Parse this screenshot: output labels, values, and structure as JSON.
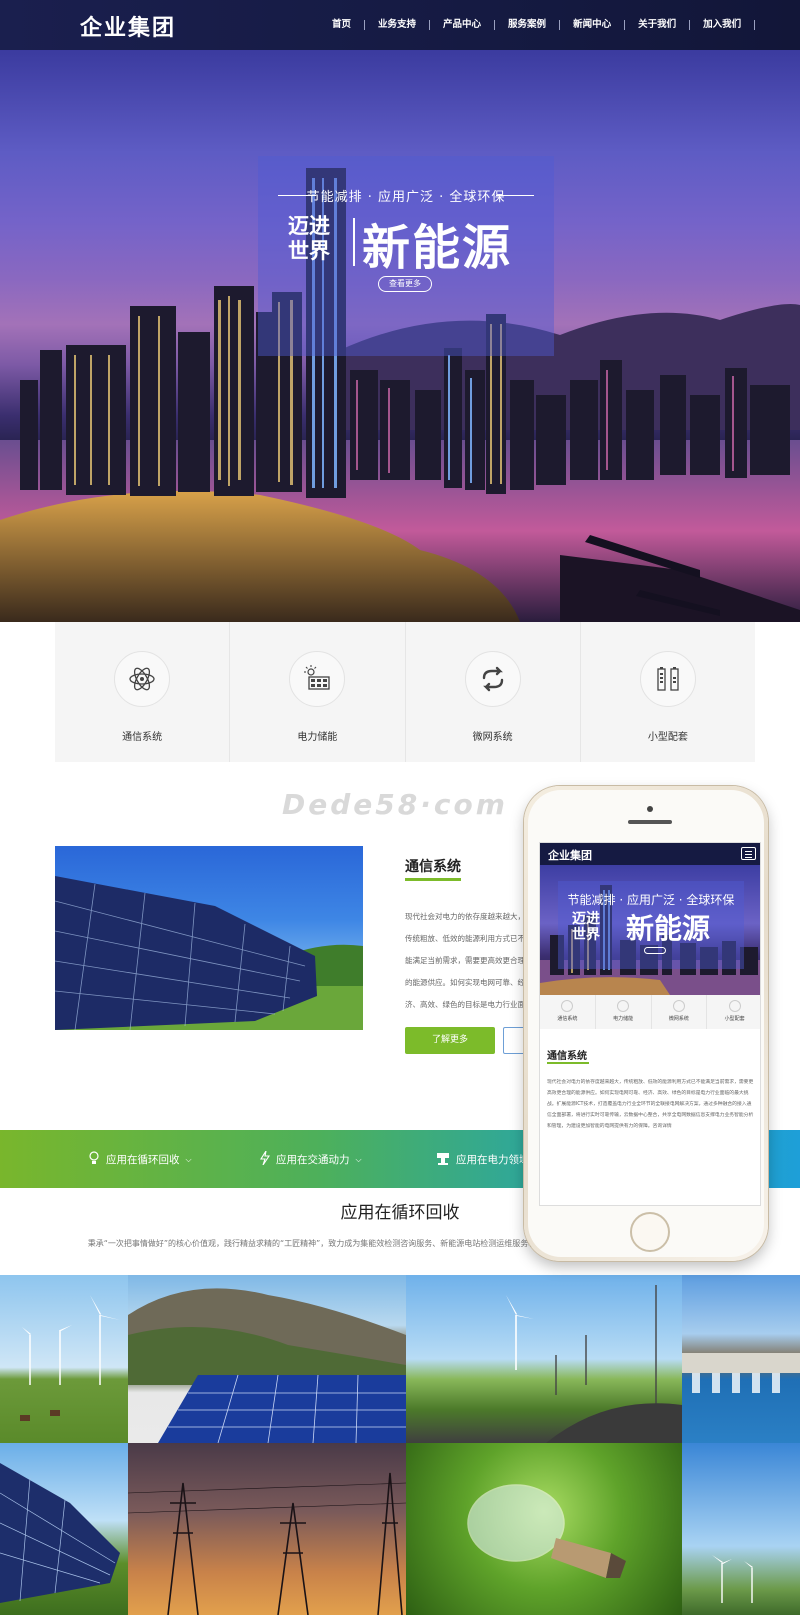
{
  "header": {
    "logo": "企业集团",
    "nav": [
      "首页",
      "业务支持",
      "产品中心",
      "服务案例",
      "新闻中心",
      "关于我们",
      "加入我们"
    ]
  },
  "hero": {
    "subtitle": "节能减排 · 应用广泛 · 全球环保",
    "small_title": "迈进世界",
    "big_title": "新能源",
    "button": "查看更多"
  },
  "features": [
    {
      "label": "通信系统",
      "icon": "atom-icon"
    },
    {
      "label": "电力储能",
      "icon": "solar-panel-icon"
    },
    {
      "label": "微网系统",
      "icon": "cycle-icon"
    },
    {
      "label": "小型配套",
      "icon": "battery-icon"
    }
  ],
  "watermark": "Dede58·com",
  "about": {
    "title": "通信系统",
    "text": "现代社会对电力的依存度越来越大，传统粗放、低效的能源利用方式已不能满足当前需求，需要更高效更合理的能源供应。如何实现电网可靠、经济、高效、绿色的目标是电力行业面临的最大挑战。扩展能源ICT技术，打造覆盖电力行业全环节的全联接电网解决方案，通过多种融合的接入通信全面部署，为电网提供有力的保障。",
    "text_visible": "现代社会对电力的依存度越来越大，传统粗放、低效的能源利用方式已不能满足当前需求，需要更高效更合理的能源供应。如何实现电网可靠、经济、高效、绿色的目标是电力行业面临的最大挑战。扩展能源ICT技术，打造覆盖电力行业全环节的全联接电网解决方案，通过多种融合的接入通信全面部署，将进行实时可靠传输，云数据中心整合，为电网提供有力的保障。咨询详情",
    "button": "了解更多"
  },
  "band": {
    "items": [
      "应用在循环回收",
      "应用在交通动力",
      "应用在电力领域"
    ]
  },
  "section": {
    "title": "应用在循环回收",
    "desc": "秉承“一次把事情做好”的核心价值观，践行精益求精的“工匠精神”，致力成为集能效检测咨询服务、新能源电站检测运维服务机构。"
  },
  "phone": {
    "logo": "企业集团",
    "subtitle": "节能减排 · 应用广泛 · 全球环保",
    "small_title": "迈进世界",
    "big_title": "新能源",
    "features": [
      "通信系统",
      "电力储能",
      "微网系统",
      "小型配套"
    ],
    "title": "通信系统",
    "text": "现代社会对电力的依存度越来越大，传统粗放、低效的能源利用方式已不能满足当前需求，需要更高效更合理的能源供应。如何实现电网可靠、经济、高效、绿色的目标是电力行业面临的最大挑战。扩展能源ICT技术，打造覆盖电力行业全环节的全联接电网解决方案，通过多种融合的接入通信全面部署，将进行实时可靠传输，云数据中心整合，共享全电网数据信息支撑电力业务智能分析和管理，为建设更加智能的电网提供有力的保障。咨询详情"
  },
  "colors": {
    "header_bg": "#151a42",
    "accent_green": "#7cbb2a",
    "band_start": "#79b62c",
    "band_end": "#1e9fd8"
  }
}
